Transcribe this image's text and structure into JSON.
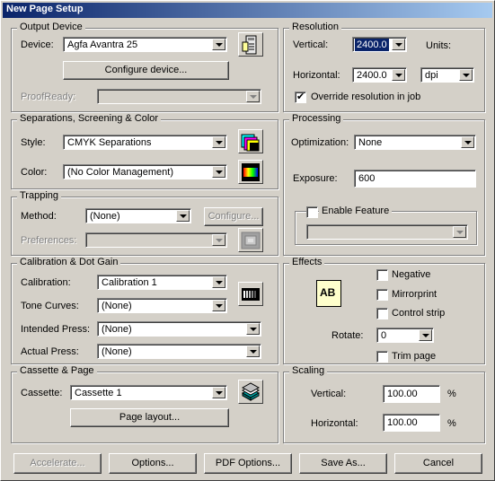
{
  "window": {
    "title": "New Page Setup"
  },
  "output_device": {
    "legend": "Output Device",
    "device_label": "Device:",
    "device_value": "Agfa Avantra 25",
    "configure_button": "Configure device...",
    "proofready_label": "ProofReady:",
    "proofready_value": ""
  },
  "separations": {
    "legend": "Separations, Screening & Color",
    "style_label": "Style:",
    "style_value": "CMYK Separations",
    "color_label": "Color:",
    "color_value": "(No Color Management)"
  },
  "trapping": {
    "legend": "Trapping",
    "method_label": "Method:",
    "method_value": "(None)",
    "configure_button": "Configure...",
    "preferences_label": "Preferences:",
    "preferences_value": ""
  },
  "calibration": {
    "legend": "Calibration & Dot Gain",
    "calibration_label": "Calibration:",
    "calibration_value": "Calibration 1",
    "tone_curves_label": "Tone Curves:",
    "tone_curves_value": "(None)",
    "intended_press_label": "Intended Press:",
    "intended_press_value": "(None)",
    "actual_press_label": "Actual Press:",
    "actual_press_value": "(None)"
  },
  "cassette": {
    "legend": "Cassette & Page",
    "cassette_label": "Cassette:",
    "cassette_value": "Cassette 1",
    "page_layout_button": "Page layout..."
  },
  "resolution": {
    "legend": "Resolution",
    "vertical_label": "Vertical:",
    "vertical_value": "2400.0",
    "horizontal_label": "Horizontal:",
    "horizontal_value": "2400.0",
    "units_label": "Units:",
    "units_value": "dpi",
    "override_label": "Override resolution in job",
    "override_checked": true
  },
  "processing": {
    "legend": "Processing",
    "optimization_label": "Optimization:",
    "optimization_value": "None",
    "exposure_label": "Exposure:",
    "exposure_value": "600",
    "enable_feature_label": "Enable Feature",
    "enable_feature_checked": false,
    "feature_value": ""
  },
  "effects": {
    "legend": "Effects",
    "icon_text": "AB",
    "negative_label": "Negative",
    "mirrorprint_label": "Mirrorprint",
    "control_strip_label": "Control strip",
    "rotate_label": "Rotate:",
    "rotate_value": "0",
    "trim_page_label": "Trim page"
  },
  "scaling": {
    "legend": "Scaling",
    "vertical_label": "Vertical:",
    "vertical_value": "100.00",
    "horizontal_label": "Horizontal:",
    "horizontal_value": "100.00",
    "unit_symbol": "%"
  },
  "buttons": {
    "accelerate": "Accelerate...",
    "options": "Options...",
    "pdf_options": "PDF Options...",
    "save_as": "Save As...",
    "cancel": "Cancel"
  }
}
